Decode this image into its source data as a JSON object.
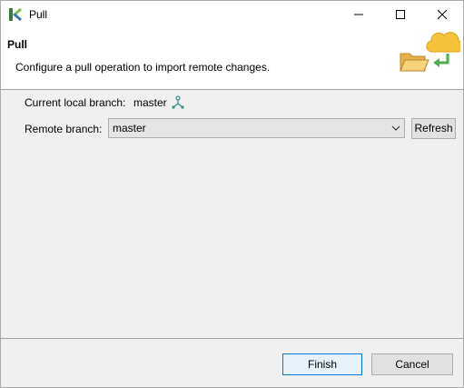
{
  "window": {
    "title": "Pull"
  },
  "header": {
    "title": "Pull",
    "description": "Configure a pull operation to import remote changes."
  },
  "form": {
    "current_branch_label": "Current local branch:",
    "current_branch_value": "master",
    "remote_branch_label": "Remote branch:",
    "remote_branch_value": "master",
    "refresh_label": "Refresh"
  },
  "footer": {
    "finish_label": "Finish",
    "cancel_label": "Cancel"
  },
  "icons": {
    "app": "app-logo-icon",
    "minimize": "minimize-icon",
    "maximize": "maximize-icon",
    "close": "close-icon",
    "header": "folder-cloud-pull-icon",
    "branch": "branch-icon",
    "dropdown": "chevron-down-icon"
  },
  "colors": {
    "accent": "#0078d7",
    "window_bg": "#f0f0f0"
  }
}
